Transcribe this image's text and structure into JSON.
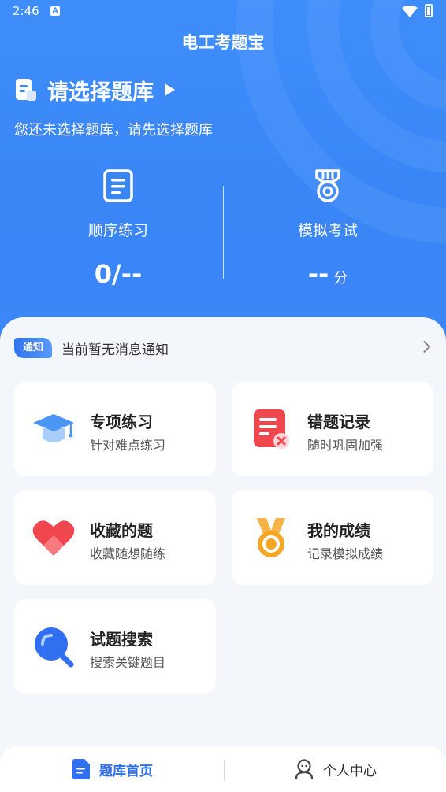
{
  "status_bar": {
    "time": "2:46",
    "badge": "A"
  },
  "header": {
    "title": "电工考题宝"
  },
  "bank": {
    "title": "请选择题库",
    "subtitle": "您还未选择题库，请先选择题库"
  },
  "stats": {
    "sequence": {
      "label": "顺序练习",
      "value": "0/--"
    },
    "exam": {
      "label": "模拟考试",
      "value": "--",
      "unit": "分"
    }
  },
  "notice": {
    "tag": "通知",
    "text": "当前暂无消息通知"
  },
  "cards": [
    {
      "title": "专项练习",
      "subtitle": "针对难点练习",
      "icon": "graduation-cap-icon"
    },
    {
      "title": "错题记录",
      "subtitle": "随时巩固加强",
      "icon": "wrong-record-icon"
    },
    {
      "title": "收藏的题",
      "subtitle": "收藏随想随练",
      "icon": "heart-icon"
    },
    {
      "title": "我的成绩",
      "subtitle": "记录模拟成绩",
      "icon": "medal-icon"
    },
    {
      "title": "试题搜索",
      "subtitle": "搜索关键题目",
      "icon": "search-icon"
    }
  ],
  "tabs": [
    {
      "label": "题库首页",
      "active": true
    },
    {
      "label": "个人中心",
      "active": false
    }
  ],
  "colors": {
    "primary": "#3a86f7",
    "accent": "#2f6ff0",
    "danger": "#f0474f",
    "gold": "#f5a623"
  }
}
